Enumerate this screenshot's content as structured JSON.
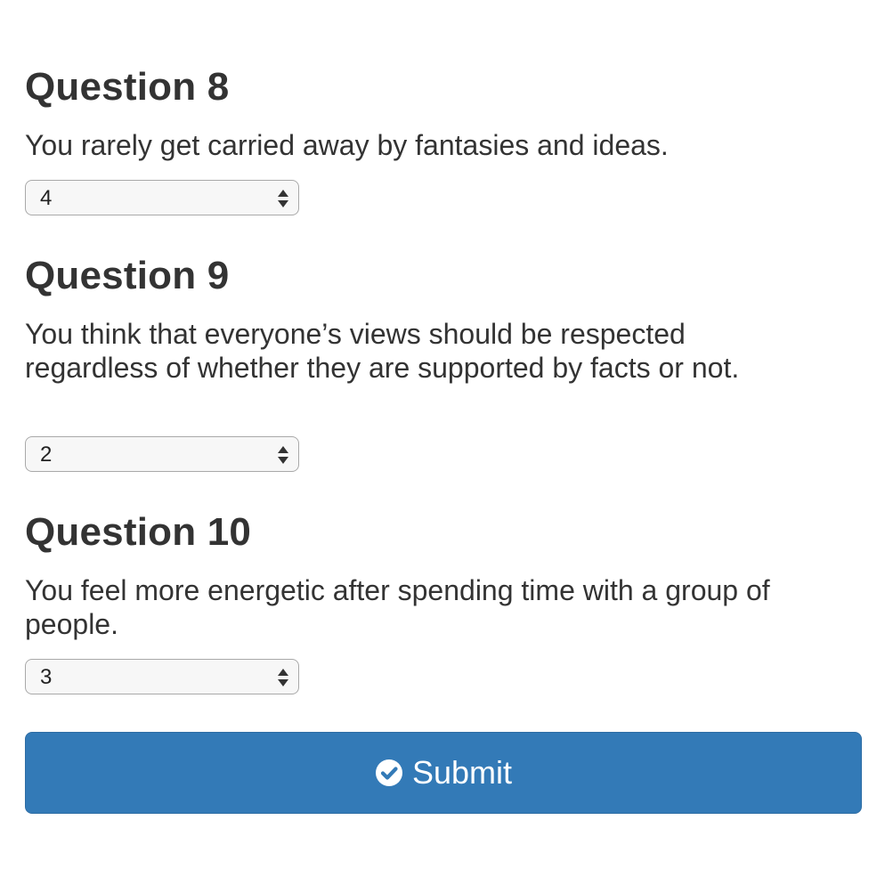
{
  "questions": [
    {
      "title": "Question 8",
      "text": "You rarely get carried away by fantasies and ideas.",
      "selected": "4"
    },
    {
      "title": "Question 9",
      "text": "You think that everyone’s views should be respected regardless of whether they are supported by facts or not.",
      "selected": "2"
    },
    {
      "title": "Question 10",
      "text": "You feel more energetic after spending time with a group of people.",
      "selected": "3"
    }
  ],
  "submit": {
    "label": "Submit",
    "icon": "check-circle-icon"
  },
  "colors": {
    "text": "#333333",
    "button": "#337ab7",
    "button_text": "#ffffff",
    "select_bg": "#f7f7f7",
    "select_border": "#a9a9a9"
  }
}
